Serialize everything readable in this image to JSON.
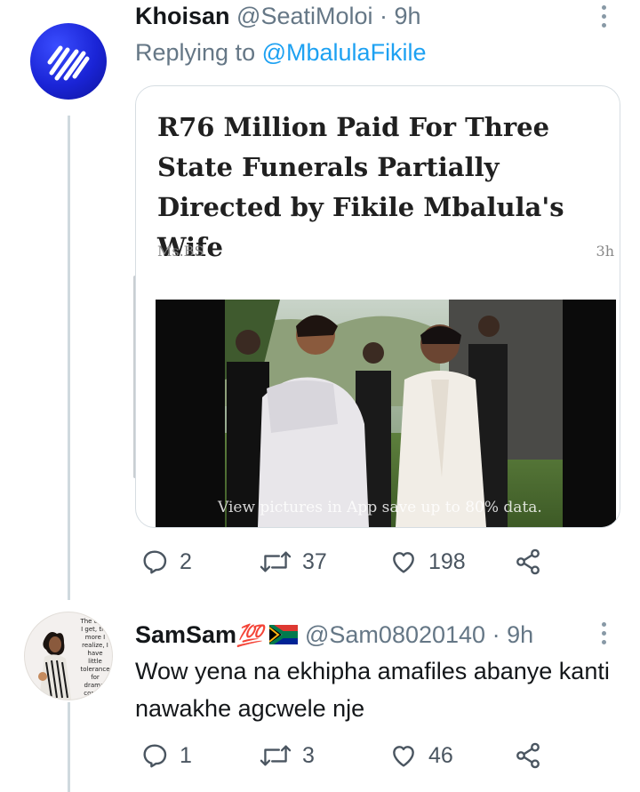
{
  "tweet1": {
    "display_name": "Khoisan",
    "handle": "@SeatiMoloi",
    "time": "· 9h",
    "replying_prefix": "Replying to",
    "replying_to": "@MbalulaFikile",
    "card": {
      "title": "R76 Million Paid For Three State Funerals Partially Directed by Fikile Mbalula's Wife",
      "source": "Ms.BS",
      "time": "3h",
      "caption": "View pictures in App save up to 80% data."
    },
    "actions": {
      "replies": "2",
      "retweets": "37",
      "likes": "198"
    }
  },
  "tweet2": {
    "display_name": "SamSam",
    "name_emoji": "💯",
    "handle": "@Sam08020140",
    "time": "· 9h",
    "text": "Wow yena na ekhipha amafiles abanye kanti nawakhe agcwele nje",
    "avatar_quote": "The older I get, the more I realize, I have little tolerance for drama, conflict and stress. I want to be around happy people, doing positive things, and enjoying",
    "actions": {
      "replies": "1",
      "retweets": "3",
      "likes": "46"
    }
  },
  "colors": {
    "accent": "#1da1f2",
    "muted": "#657786",
    "border": "#d6dde2"
  }
}
